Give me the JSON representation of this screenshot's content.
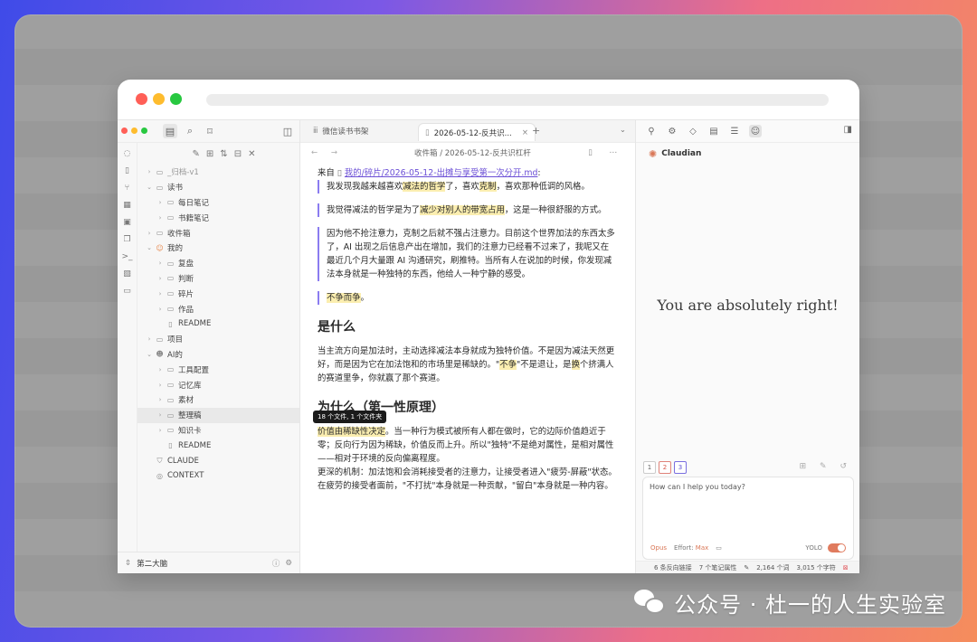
{
  "colors": {
    "accent": "#8b7cf0",
    "highlight": "#fbeeb0",
    "claude": "#d97757",
    "close": "#ff5f57",
    "minimize": "#febc2e",
    "maximize": "#28c840"
  },
  "left_top": {
    "icons": [
      "folder-icon",
      "search-icon",
      "bookmark-icon",
      "sidebar-toggle-icon"
    ]
  },
  "ribbon": [
    "chat-icon",
    "file-icon",
    "graph-icon",
    "grid-icon",
    "calendar-icon",
    "copy-icon",
    "terminal-icon",
    "blocks-icon",
    "book-icon"
  ],
  "tree_tools": [
    "new-note-icon",
    "new-folder-icon",
    "sort-icon",
    "collapse-icon",
    "close-all-icon"
  ],
  "tree": [
    {
      "label": "_归档-v1",
      "depth": 0,
      "type": "folder",
      "expanded": false,
      "muted": true
    },
    {
      "label": "读书",
      "depth": 0,
      "type": "folder",
      "expanded": true
    },
    {
      "label": "每日笔记",
      "depth": 1,
      "type": "folder",
      "expanded": false
    },
    {
      "label": "书籍笔记",
      "depth": 1,
      "type": "folder",
      "expanded": false
    },
    {
      "label": "收件箱",
      "depth": 0,
      "type": "folder",
      "expanded": false
    },
    {
      "label": "我的",
      "depth": 0,
      "type": "user",
      "expanded": true
    },
    {
      "label": "复盘",
      "depth": 1,
      "type": "folder",
      "expanded": false
    },
    {
      "label": "判断",
      "depth": 1,
      "type": "folder",
      "expanded": false
    },
    {
      "label": "碎片",
      "depth": 1,
      "type": "folder",
      "expanded": false
    },
    {
      "label": "作品",
      "depth": 1,
      "type": "folder",
      "expanded": false
    },
    {
      "label": "README",
      "depth": 1,
      "type": "file"
    },
    {
      "label": "项目",
      "depth": 0,
      "type": "folder",
      "expanded": false
    },
    {
      "label": "AI的",
      "depth": 0,
      "type": "bot",
      "expanded": true
    },
    {
      "label": "工具配置",
      "depth": 1,
      "type": "folder",
      "expanded": false
    },
    {
      "label": "记忆库",
      "depth": 1,
      "type": "folder",
      "expanded": false
    },
    {
      "label": "素材",
      "depth": 1,
      "type": "folder",
      "expanded": false
    },
    {
      "label": "整理稿",
      "depth": 1,
      "type": "folder",
      "expanded": false,
      "selected": true
    },
    {
      "label": "知识卡",
      "depth": 1,
      "type": "folder",
      "expanded": false
    },
    {
      "label": "README",
      "depth": 1,
      "type": "file"
    },
    {
      "label": "CLAUDE",
      "depth": 0,
      "type": "shield"
    },
    {
      "label": "CONTEXT",
      "depth": 0,
      "type": "compass"
    }
  ],
  "tooltip": "18 个文件, 1 个文件夹",
  "vault_name": "第二大脑",
  "tabs": {
    "tab1": "微信读书书架",
    "tab2": "2026-05-12-反共识..."
  },
  "breadcrumb": "收件箱 / 2026-05-12-反共识杠杆",
  "doc": {
    "from_prefix": "来自",
    "from_link": "我的/碎片/2026-05-12-出摊与享受第一次分开.md",
    "from_suffix": ":",
    "q1": {
      "a": "我发现我越来越喜欢",
      "h1": "减法的哲学",
      "b": "了，喜欢",
      "h2": "克制",
      "c": "，喜欢那种低调的风格。"
    },
    "q2": {
      "a": "我觉得减法的哲学是为了",
      "h1": "减少对别人的带宽占用",
      "b": "，这是一种很舒服的方式。"
    },
    "q3": "因为他不抢注意力，克制之后就不强占注意力。目前这个世界加法的东西太多了，AI 出现之后信息产出在增加，我们的注意力已经看不过来了，我呢又在最近几个月大量跟 AI 沟通研究，刷推特。当所有人在说加的时候，你发现减法本身就是一种独特的东西，他给人一种宁静的感受。",
    "q4": "不争而争",
    "q4_end": "。",
    "h_what": "是什么",
    "p_what": {
      "a": "当主流方向是加法时，主动选择减法本身就成为独特价值。不是因为减法天然更好，而是因为它在加法饱和的市场里是稀缺的。\"",
      "h": "不争",
      "b": "\"不是退让，是",
      "h2": "换",
      "c": "个挤满人的赛道里争，你就赢了那个赛道。"
    },
    "h_why": "为什么（第一性原理）",
    "p_why1": {
      "h": "价值由稀缺性决定",
      "a": "。当一种行为模式被所有人都在做时，它的边际价值趋近于零；反向行为因为稀缺，价值反而上升。所以\"独特\"不是绝对属性，是相对属性——相对于环境的反向偏离程度。"
    },
    "p_why2": "更深的机制：加法饱和会消耗接受者的注意力，让接受者进入\"疲劳-屏蔽\"状态。在疲劳的接受者面前，\"不打扰\"本身就是一种贡献，\"留白\"本身就是一种内容。"
  },
  "right_tools": [
    "plug-icon",
    "cog-link-icon",
    "tag-icon",
    "archive-icon",
    "list-icon",
    "bot-icon",
    "sidebar-right-icon"
  ],
  "claudian": {
    "name": "Claudian",
    "message": "You are absolutely right!"
  },
  "chips": [
    "1",
    "2",
    "3"
  ],
  "composer": {
    "placeholder": "How can I help you today?",
    "model": "Opus",
    "effort_label": "Effort:",
    "effort_value": "Max",
    "yolo": "YOLO"
  },
  "status": {
    "backlinks": "6 条反向链接",
    "props": "7 个笔记属性",
    "words": "2,164 个词",
    "chars": "3,015 个字符"
  },
  "watermark": "公众号 · 杜一的人生实验室"
}
